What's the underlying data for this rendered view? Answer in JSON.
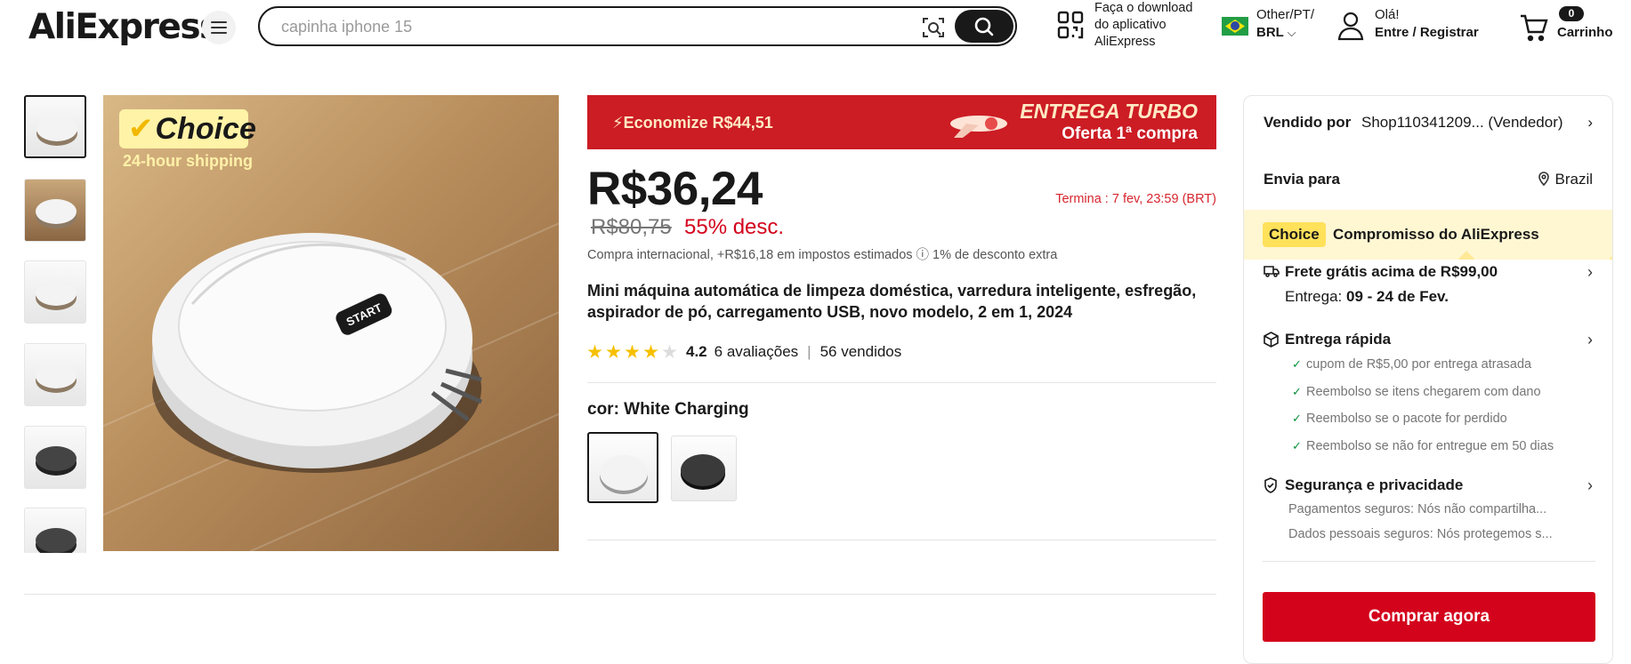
{
  "header": {
    "logo_text": "AliExpress",
    "search_placeholder": "capinha iphone 15",
    "app_download": [
      "Faça o download",
      "do aplicativo",
      "AliExpress"
    ],
    "region": {
      "line1": "Other/PT/",
      "line2": "BRL"
    },
    "account": {
      "greeting": "Olá!",
      "action": "Entre / Registrar"
    },
    "cart": {
      "count": "0",
      "label": "Carrinho"
    }
  },
  "gallery": {
    "badge_text": "Choice",
    "shipping_text": "24-hour shipping",
    "start_label": "START"
  },
  "product": {
    "promo_save": "Economize R$44,51",
    "promo_turbo_1": "ENTREGA TURBO",
    "promo_turbo_2": "Oferta 1ª compra",
    "price": "R$36,24",
    "ends": "Termina :  7 fev, 23:59 (BRT)",
    "old_price": "R$80,75",
    "discount": "55% desc.",
    "tax_note": "Compra internacional, +R$16,18 em impostos estimados ⓘ 1% de desconto extra",
    "title": "Mini máquina automática de limpeza doméstica, varredura inteligente, esfregão, aspirador de pó, carregamento USB, novo modelo, 2 em 1, 2024",
    "rating": "4.2",
    "rating_stars": 4.2,
    "reviews": "6 avaliações",
    "sold": "56 vendidos",
    "color_label": "cor: White Charging"
  },
  "panel": {
    "sold_by_label": "Vendido por",
    "shop": "Shop110341209... (Vendedor)",
    "ships_to_label": "Envia para",
    "ships_to": "Brazil",
    "choice_tag": "Choice",
    "choice_text": "Compromisso do AliExpress",
    "free_ship": "Frete grátis acima de R$99,00",
    "delivery_prefix": "Entrega: ",
    "delivery_dates": "09 - 24 de Fev.",
    "fast_delivery": "Entrega rápida",
    "guarantees": [
      "cupom de R$5,00 por entrega atrasada",
      "Reembolso se itens chegarem com dano",
      "Reembolso se o pacote for perdido",
      "Reembolso se não for entregue em 50 dias"
    ],
    "security": "Segurança e privacidade",
    "security_items": [
      "Pagamentos seguros: Nós não compartilha...",
      "Dados pessoais seguros: Nós protegemos s..."
    ],
    "buy_now": "Comprar agora"
  },
  "colors": {
    "brand_red": "#d3031c",
    "promo_red": "#cc1c24",
    "choice_yellow": "#ffe15a"
  }
}
